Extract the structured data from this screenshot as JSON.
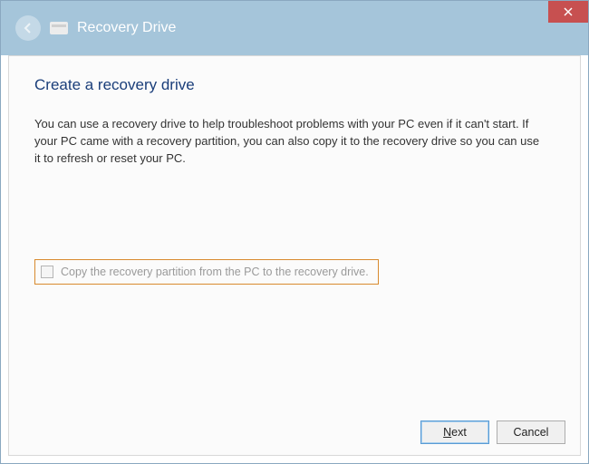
{
  "titlebar": {
    "title": "Recovery Drive"
  },
  "content": {
    "heading": "Create a recovery drive",
    "body": "You can use a recovery drive to help troubleshoot problems with your PC even if it can't start. If your PC came with a recovery partition, you can also copy it to the recovery drive so you can use it to refresh or reset your PC."
  },
  "checkbox": {
    "label": "Copy the recovery partition from the PC to the recovery drive.",
    "checked": false,
    "enabled": false
  },
  "footer": {
    "next_prefix": "N",
    "next_rest": "ext",
    "cancel": "Cancel"
  }
}
